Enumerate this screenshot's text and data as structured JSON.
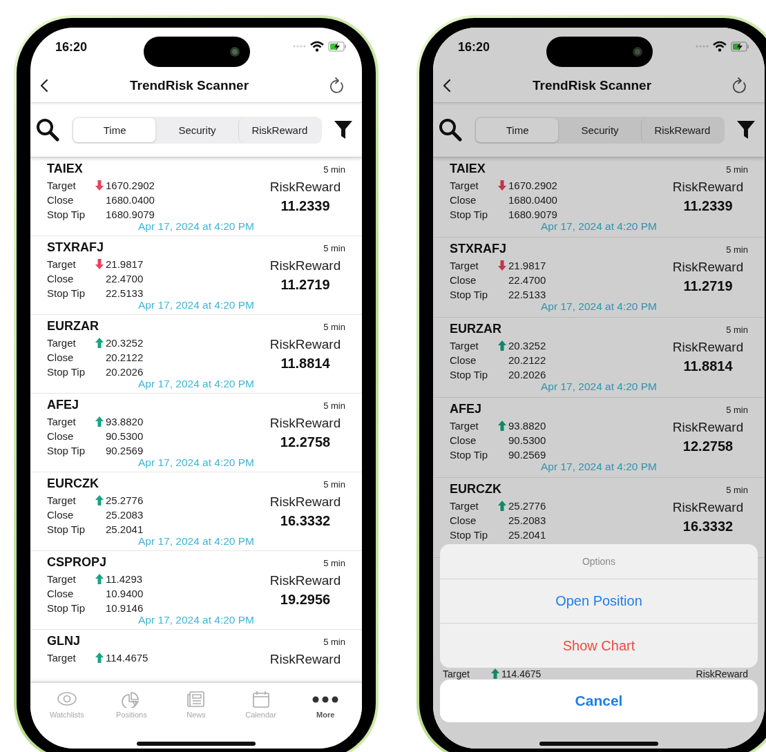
{
  "phones": [
    {
      "dimmed": false,
      "status_bar": {
        "time": "16:20"
      },
      "nav": {
        "title": "TrendRisk Scanner"
      },
      "segments": [
        {
          "label": "Time",
          "selected": true
        },
        {
          "label": "Security",
          "selected": false
        },
        {
          "label": "RiskReward",
          "selected": false
        }
      ],
      "rows": [
        {
          "name": "TAIEX",
          "interval": "5 min",
          "lines": [
            {
              "label": "Target",
              "rising": false,
              "value": "1670.2902"
            },
            {
              "label": "Close",
              "value": "1680.0400"
            },
            {
              "label": "Stop Tip",
              "value": "1680.9079"
            }
          ],
          "risk_label": "RiskReward",
          "risk_value": "11.2339",
          "date": "Apr 17, 2024 at 4:20 PM"
        },
        {
          "name": "STXRAFJ",
          "interval": "5 min",
          "lines": [
            {
              "label": "Target",
              "rising": false,
              "value": "21.9817"
            },
            {
              "label": "Close",
              "value": "22.4700"
            },
            {
              "label": "Stop Tip",
              "value": "22.5133"
            }
          ],
          "risk_label": "RiskReward",
          "risk_value": "11.2719",
          "date": "Apr 17, 2024 at 4:20 PM"
        },
        {
          "name": "EURZAR",
          "interval": "5 min",
          "lines": [
            {
              "label": "Target",
              "rising": true,
              "value": "20.3252"
            },
            {
              "label": "Close",
              "value": "20.2122"
            },
            {
              "label": "Stop Tip",
              "value": "20.2026"
            }
          ],
          "risk_label": "RiskReward",
          "risk_value": "11.8814",
          "date": "Apr 17, 2024 at 4:20 PM"
        },
        {
          "name": "AFEJ",
          "interval": "5 min",
          "lines": [
            {
              "label": "Target",
              "rising": true,
              "value": "93.8820"
            },
            {
              "label": "Close",
              "value": "90.5300"
            },
            {
              "label": "Stop Tip",
              "value": "90.2569"
            }
          ],
          "risk_label": "RiskReward",
          "risk_value": "12.2758",
          "date": "Apr 17, 2024 at 4:20 PM"
        },
        {
          "name": "EURCZK",
          "interval": "5 min",
          "lines": [
            {
              "label": "Target",
              "rising": true,
              "value": "25.2776"
            },
            {
              "label": "Close",
              "value": "25.2083"
            },
            {
              "label": "Stop Tip",
              "value": "25.2041"
            }
          ],
          "risk_label": "RiskReward",
          "risk_value": "16.3332",
          "date": "Apr 17, 2024 at 4:20 PM"
        },
        {
          "name": "CSPROPJ",
          "interval": "5 min",
          "lines": [
            {
              "label": "Target",
              "rising": true,
              "value": "11.4293"
            },
            {
              "label": "Close",
              "value": "10.9400"
            },
            {
              "label": "Stop Tip",
              "value": "10.9146"
            }
          ],
          "risk_label": "RiskReward",
          "risk_value": "19.2956",
          "date": "Apr 17, 2024 at 4:20 PM"
        },
        {
          "name": "GLNJ",
          "interval": "5 min",
          "lines": [
            {
              "label": "Target",
              "rising": true,
              "value": "114.4675"
            }
          ],
          "risk_label": "RiskReward"
        }
      ],
      "tab_bar": [
        {
          "label": "Watchlists",
          "selected": false
        },
        {
          "label": "Positions",
          "selected": false
        },
        {
          "label": "News",
          "selected": false
        },
        {
          "label": "Calendar",
          "selected": false
        },
        {
          "label": "More",
          "selected": true
        }
      ]
    },
    {
      "dimmed": true,
      "status_bar": {
        "time": "16:20"
      },
      "nav": {
        "title": "TrendRisk Scanner"
      },
      "segments": [
        {
          "label": "Time",
          "selected": true
        },
        {
          "label": "Security",
          "selected": false
        },
        {
          "label": "RiskReward",
          "selected": false
        }
      ],
      "rows": [
        {
          "name": "TAIEX",
          "interval": "5 min",
          "lines": [
            {
              "label": "Target",
              "rising": false,
              "value": "1670.2902"
            },
            {
              "label": "Close",
              "value": "1680.0400"
            },
            {
              "label": "Stop Tip",
              "value": "1680.9079"
            }
          ],
          "risk_label": "RiskReward",
          "risk_value": "11.2339",
          "date": "Apr 17, 2024 at 4:20 PM"
        },
        {
          "name": "STXRAFJ",
          "interval": "5 min",
          "lines": [
            {
              "label": "Target",
              "rising": false,
              "value": "21.9817"
            },
            {
              "label": "Close",
              "value": "22.4700"
            },
            {
              "label": "Stop Tip",
              "value": "22.5133"
            }
          ],
          "risk_label": "RiskReward",
          "risk_value": "11.2719",
          "date": "Apr 17, 2024 at 4:20 PM"
        },
        {
          "name": "EURZAR",
          "interval": "5 min",
          "lines": [
            {
              "label": "Target",
              "rising": true,
              "value": "20.3252"
            },
            {
              "label": "Close",
              "value": "20.2122"
            },
            {
              "label": "Stop Tip",
              "value": "20.2026"
            }
          ],
          "risk_label": "RiskReward",
          "risk_value": "11.8814",
          "date": "Apr 17, 2024 at 4:20 PM"
        },
        {
          "name": "AFEJ",
          "interval": "5 min",
          "lines": [
            {
              "label": "Target",
              "rising": true,
              "value": "93.8820"
            },
            {
              "label": "Close",
              "value": "90.5300"
            },
            {
              "label": "Stop Tip",
              "value": "90.2569"
            }
          ],
          "risk_label": "RiskReward",
          "risk_value": "12.2758",
          "date": "Apr 17, 2024 at 4:20 PM"
        },
        {
          "name": "EURCZK",
          "interval": "5 min",
          "lines": [
            {
              "label": "Target",
              "rising": true,
              "value": "25.2776"
            },
            {
              "label": "Close",
              "value": "25.2083"
            },
            {
              "label": "Stop Tip",
              "value": "25.2041"
            }
          ],
          "risk_label": "RiskReward",
          "risk_value": "16.3332"
        }
      ],
      "action_sheet": {
        "title": "Options",
        "actions": [
          {
            "label": "Open Position",
            "kind": "default"
          },
          {
            "label": "Show Chart",
            "kind": "destructive"
          }
        ],
        "peek_row": {
          "label": "Target",
          "rising": true,
          "value": "114.4675",
          "risk_label": "RiskReward"
        },
        "cancel": "Cancel"
      }
    }
  ]
}
